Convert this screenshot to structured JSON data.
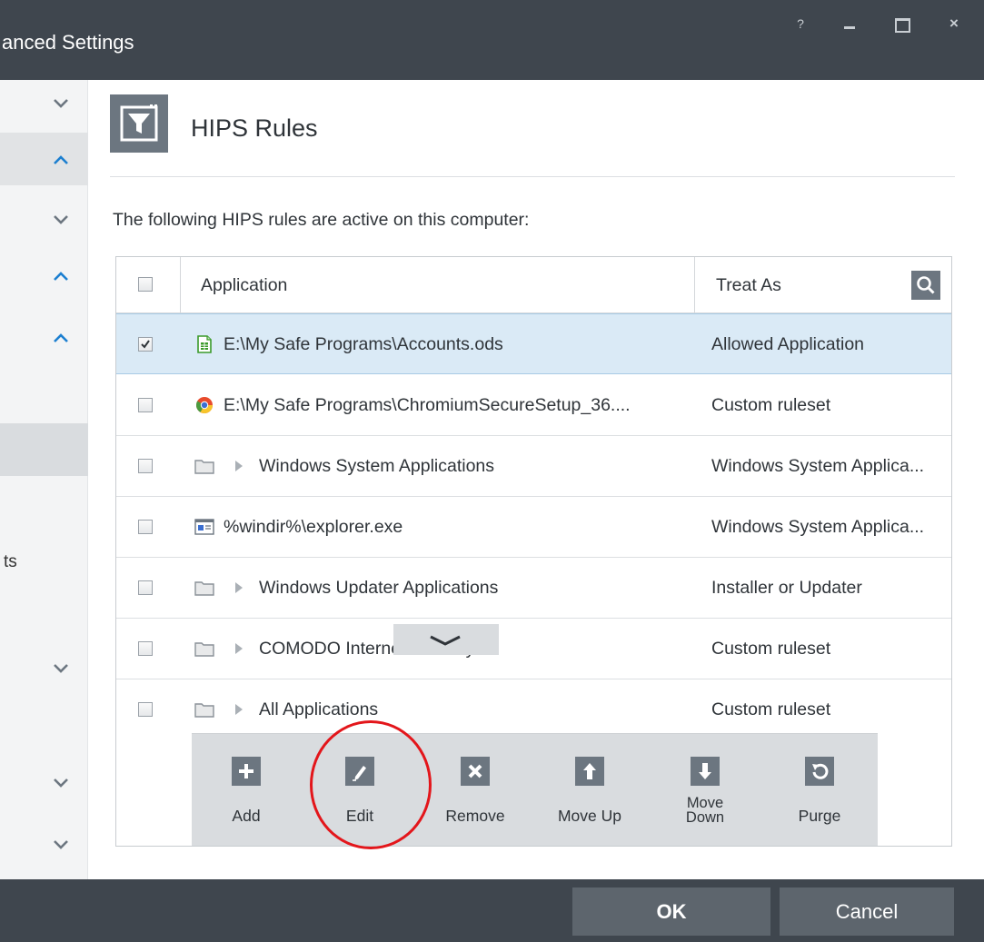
{
  "window": {
    "title": "anced Settings",
    "controls": {
      "help": "?",
      "minimize": "minimize",
      "maximize": "maximize",
      "close": "×"
    }
  },
  "sidebar": {
    "partial_label": "ts",
    "arrows": [
      "chevron-down",
      "chevron-up",
      "chevron-down",
      "chevron-up",
      "chevron-up",
      "chevron-down",
      "chevron-down",
      "chevron-down"
    ]
  },
  "header": {
    "title": "HIPS Rules",
    "icon": "filter-icon"
  },
  "description": "The following HIPS rules are active on this computer:",
  "table": {
    "columns": {
      "application": "Application",
      "treat_as": "Treat As"
    },
    "rows": [
      {
        "checked": true,
        "icon": "spreadsheet-icon",
        "expandable": false,
        "application": "E:\\My Safe Programs\\Accounts.ods",
        "treat_as": "Allowed Application"
      },
      {
        "checked": false,
        "icon": "chromium-icon",
        "expandable": false,
        "application": "E:\\My Safe Programs\\ChromiumSecureSetup_36....",
        "treat_as": "Custom ruleset"
      },
      {
        "checked": false,
        "icon": "folder-icon",
        "expandable": true,
        "application": "Windows System Applications",
        "treat_as": "Windows System Applica..."
      },
      {
        "checked": false,
        "icon": "exe-icon",
        "expandable": false,
        "application": "%windir%\\explorer.exe",
        "treat_as": "Windows System Applica..."
      },
      {
        "checked": false,
        "icon": "folder-icon",
        "expandable": true,
        "application": "Windows Updater Applications",
        "treat_as": "Installer or Updater"
      },
      {
        "checked": false,
        "icon": "folder-icon",
        "expandable": true,
        "application": "COMODO Internet Security",
        "treat_as": "Custom ruleset"
      },
      {
        "checked": false,
        "icon": "folder-icon",
        "expandable": true,
        "application": "All Applications",
        "treat_as": "Custom ruleset"
      }
    ]
  },
  "toolbar": {
    "add": "Add",
    "edit": "Edit",
    "remove": "Remove",
    "move_up": "Move Up",
    "move_down_1": "Move",
    "move_down_2": "Down",
    "purge": "Purge"
  },
  "buttons": {
    "ok": "OK",
    "cancel": "Cancel"
  },
  "colors": {
    "titlebar": "#3f464e",
    "icon_gray": "#6c7680",
    "selection": "#daeaf6",
    "accent_blue": "#1c7fd0",
    "highlight_circle": "#e3161b"
  }
}
